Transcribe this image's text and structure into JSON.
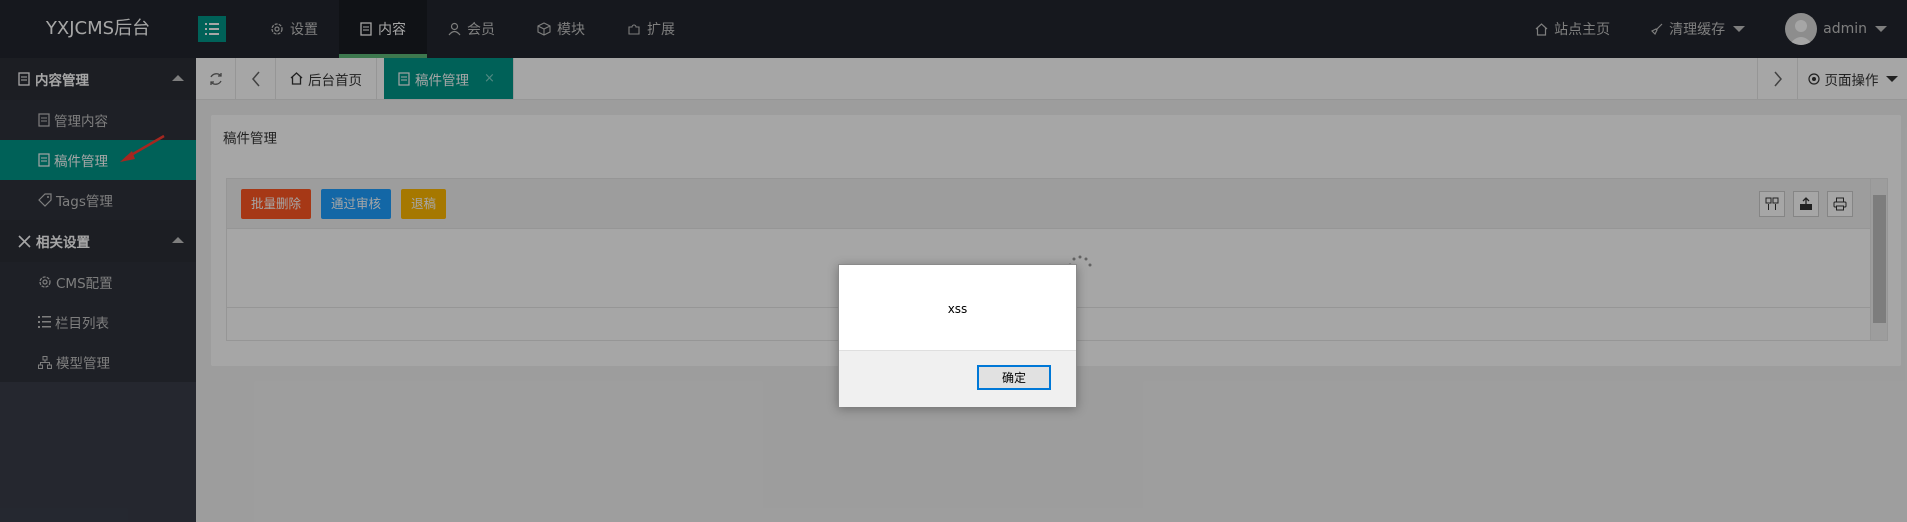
{
  "app": {
    "title": "YXJCMS后台"
  },
  "topnav": {
    "items": [
      {
        "label": "设置",
        "icon": "gear-icon"
      },
      {
        "label": "内容",
        "icon": "document-icon",
        "active": true
      },
      {
        "label": "会员",
        "icon": "user-icon"
      },
      {
        "label": "模块",
        "icon": "cube-icon"
      },
      {
        "label": "扩展",
        "icon": "puzzle-icon"
      }
    ],
    "site_home": "站点主页",
    "clear_cache": "清理缓存",
    "user": "admin"
  },
  "sidebar": {
    "groups": [
      {
        "label": "内容管理",
        "items": [
          "管理内容",
          "稿件管理",
          "Tags管理"
        ],
        "active_item": "稿件管理"
      },
      {
        "label": "相关设置",
        "items": [
          "CMS配置",
          "栏目列表",
          "模型管理"
        ]
      }
    ]
  },
  "tabs": {
    "home": "后台首页",
    "current": "稿件管理",
    "close": "×",
    "page_ops": "页面操作"
  },
  "main": {
    "card_title": "稿件管理",
    "buttons": {
      "batch_delete": "批量删除",
      "approve": "通过审核",
      "reject": "退稿"
    }
  },
  "dialog": {
    "message": "xss",
    "ok": "确定"
  },
  "colors": {
    "accent": "#009688",
    "danger": "#ff5722",
    "primary": "#1e9fff",
    "warn": "#ffb800",
    "topbar": "#23262e"
  }
}
